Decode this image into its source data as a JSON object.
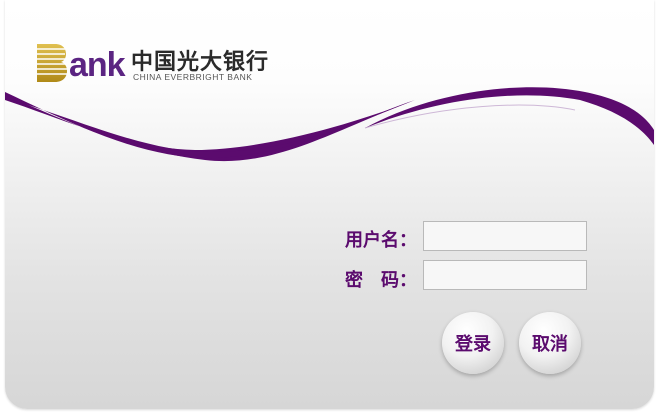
{
  "brand": {
    "logo_b": "B",
    "logo_ank": "ank",
    "name_cn": "中国光大银行",
    "name_en": "CHINA EVERBRIGHT BANK"
  },
  "login": {
    "username_label": "用户名：",
    "password_label_1": "密",
    "password_label_2": "码：",
    "username_value": "",
    "password_value": "",
    "login_button": "登录",
    "cancel_button": "取消"
  },
  "colors": {
    "accent_purple": "#5b0b6e",
    "logo_gold": "#c9a227"
  }
}
